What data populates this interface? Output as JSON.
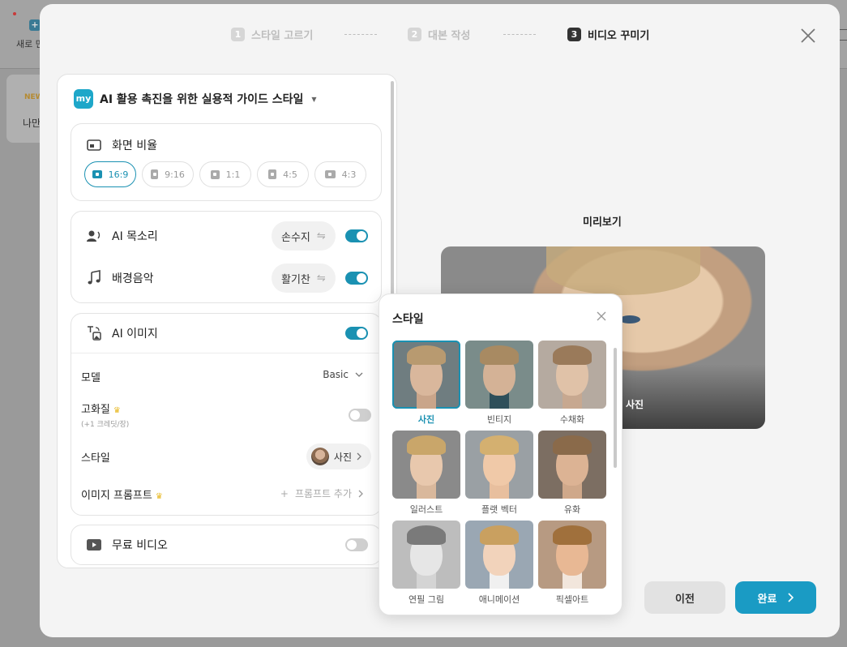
{
  "background": {
    "new_button_label": "새로 만",
    "new_badge": "NEW",
    "card_text": "나만"
  },
  "stepper": {
    "steps": [
      {
        "num": "1",
        "label": "스타일 고르기"
      },
      {
        "num": "2",
        "label": "대본 작성"
      },
      {
        "num": "3",
        "label": "비디오 꾸미기"
      }
    ],
    "active_index": 2
  },
  "panel": {
    "logo_text": "my",
    "title": "AI 활용 촉진을 위한 실용적 가이드 스타일",
    "aspect": {
      "label": "화면 비율",
      "options": [
        "16:9",
        "9:16",
        "1:1",
        "4:5",
        "4:3"
      ],
      "selected": "16:9"
    },
    "voice": {
      "label": "AI 목소리",
      "value": "손수지",
      "enabled": true
    },
    "music": {
      "label": "배경음악",
      "value": "활기찬",
      "enabled": true
    },
    "ai_image": {
      "label": "AI 이미지",
      "enabled": true,
      "model_label": "모델",
      "model_value": "Basic",
      "hq_label": "고화질",
      "hq_hint": "(+1 크레딧/장)",
      "hq_enabled": false,
      "style_label": "스타일",
      "style_value": "사진",
      "prompt_label": "이미지 프롬프트",
      "prompt_add": "프롬프트 추가"
    },
    "free_video": {
      "label": "무료 비디오",
      "enabled": false
    }
  },
  "preview": {
    "label": "미리보기",
    "caption": "사진"
  },
  "style_popup": {
    "title": "스타일",
    "selected": "사진",
    "items": [
      "사진",
      "빈티지",
      "수채화",
      "일러스트",
      "플랫 벡터",
      "유화",
      "연필 그림",
      "애니메이션",
      "픽셀아트"
    ]
  },
  "buttons": {
    "prev": "이전",
    "done": "완료"
  },
  "colors": {
    "accent": "#1a91b2",
    "done_button": "#1a9bc4",
    "crown": "#e8b923"
  }
}
